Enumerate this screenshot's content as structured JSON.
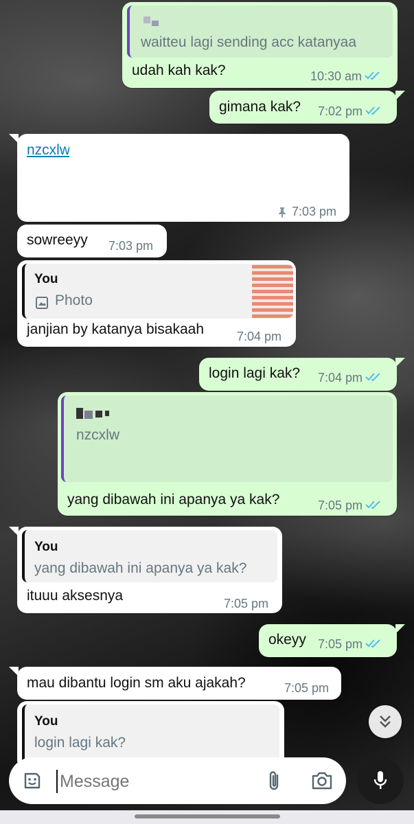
{
  "messages": [
    {
      "id": "m1",
      "dir": "out",
      "quote": {
        "author": "",
        "text": "waitteu lagi sending acc katanyaa"
      },
      "text": "udah kah kak?",
      "time": "10:30 am",
      "status": "read"
    },
    {
      "id": "m2",
      "dir": "out",
      "text": "gimana kak?",
      "time": "7:02 pm",
      "status": "read"
    },
    {
      "id": "m3",
      "dir": "in",
      "text": "nzcxlw",
      "pinned": true,
      "time": "7:03 pm"
    },
    {
      "id": "m4",
      "dir": "in",
      "text": "sowreeyy",
      "time": "7:03 pm"
    },
    {
      "id": "m5",
      "dir": "in",
      "quote": {
        "author": "You",
        "text": "Photo"
      },
      "text": "janjian by katanya bisakaah",
      "time": "7:04 pm"
    },
    {
      "id": "m6",
      "dir": "out",
      "text": "login lagi kak?",
      "time": "7:04 pm",
      "status": "read"
    },
    {
      "id": "m7",
      "dir": "out",
      "quote": {
        "author": "",
        "text": "nzcxlw"
      },
      "text": "yang dibawah ini apanya ya kak?",
      "time": "7:05 pm",
      "status": "read"
    },
    {
      "id": "m8",
      "dir": "in",
      "quote": {
        "author": "You",
        "text": "yang dibawah ini apanya ya kak?"
      },
      "text": "ituuu aksesnya",
      "time": "7:05 pm"
    },
    {
      "id": "m9",
      "dir": "out",
      "text": "okeyy",
      "time": "7:05 pm",
      "status": "read"
    },
    {
      "id": "m10",
      "dir": "in",
      "text": "mau dibantu login sm aku ajakah?",
      "time": "7:05 pm"
    },
    {
      "id": "m11",
      "dir": "in",
      "quote": {
        "author": "You",
        "text": "login lagi kak?"
      },
      "text": "",
      "time": ""
    }
  ],
  "composer": {
    "placeholder": "Message"
  },
  "icons": {
    "emoji": "sticker-icon",
    "attach": "paperclip-icon",
    "camera": "camera-icon",
    "mic": "microphone-icon",
    "scroll": "double-chevron-down-icon",
    "read": "double-check-icon",
    "pin": "pin-icon",
    "photo": "image-icon"
  },
  "colors": {
    "outgoing": "#d9fdd3",
    "incoming": "#ffffff",
    "read_tick": "#53bdeb",
    "link": "#027eb5",
    "quote_bar_out": "#6f42c1"
  }
}
